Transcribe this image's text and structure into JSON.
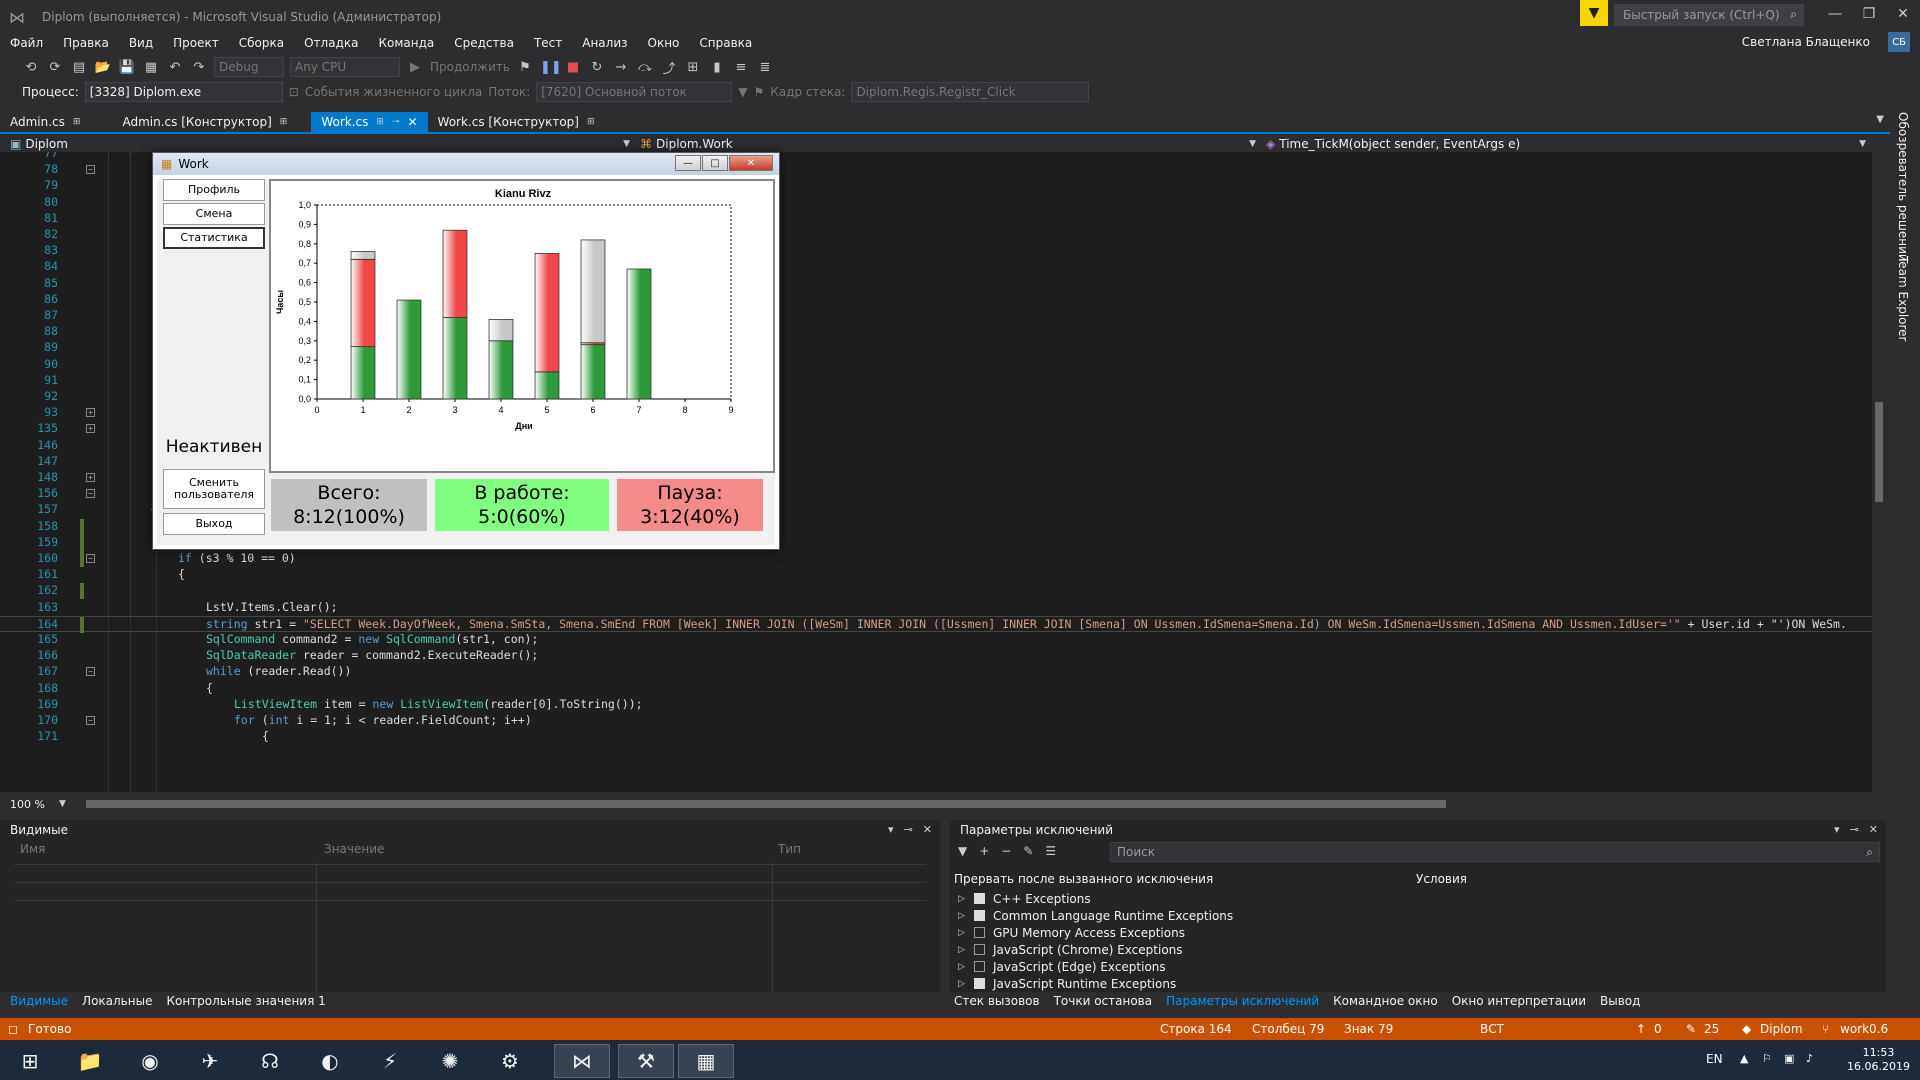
{
  "window": {
    "title": "Diplom (выполняется) - Microsoft Visual Studio  (Администратор)",
    "quick_launch_placeholder": "Быстрый запуск (Ctrl+Q)",
    "user_name": "Светлана Блащенко",
    "user_initials": "СБ"
  },
  "menu": [
    "Файл",
    "Правка",
    "Вид",
    "Проект",
    "Сборка",
    "Отладка",
    "Команда",
    "Средства",
    "Тест",
    "Анализ",
    "Окно",
    "Справка"
  ],
  "toolbar": {
    "config": "Debug",
    "platform": "Any CPU",
    "continue_label": "Продолжить"
  },
  "process_bar": {
    "process_label": "Процесс:",
    "process_value": "[3328] Diplom.exe",
    "lifecycle_label": "События жизненного цикла",
    "thread_label": "Поток:",
    "thread_value": "[7620] Основной поток",
    "stack_label": "Кадр стека:",
    "stack_value": "Diplom.Regis.Registr_Click"
  },
  "tabs": [
    {
      "label": "Admin.cs",
      "active": false
    },
    {
      "label": "Admin.cs [Конструктор]",
      "active": false
    },
    {
      "label": "Work.cs",
      "active": true
    },
    {
      "label": "Work.cs [Конструктор]",
      "active": false
    }
  ],
  "navbar": {
    "project": "Diplom",
    "class": "Diplom.Work",
    "member": "Time_TickM(object sender, EventArgs e)"
  },
  "code_lines": [
    {
      "n": "77",
      "text": ""
    },
    {
      "n": "78",
      "text": ""
    },
    {
      "n": "79",
      "text": ""
    },
    {
      "n": "80",
      "text": ""
    },
    {
      "n": "81",
      "text": ""
    },
    {
      "n": "82",
      "text": ""
    },
    {
      "n": "83",
      "text": ""
    },
    {
      "n": "84",
      "text": ""
    },
    {
      "n": "85",
      "text": ""
    },
    {
      "n": "86",
      "text": ""
    },
    {
      "n": "87",
      "text": ""
    },
    {
      "n": "88",
      "text": ""
    },
    {
      "n": "89",
      "text": ""
    },
    {
      "n": "90",
      "text": ""
    },
    {
      "n": "91",
      "text": ""
    },
    {
      "n": "92",
      "text": ""
    },
    {
      "n": "93",
      "text": ""
    },
    {
      "n": "135",
      "text": ""
    },
    {
      "n": "146",
      "text": ""
    },
    {
      "n": "147",
      "text": ""
    },
    {
      "n": "148",
      "text": ""
    },
    {
      "n": "156",
      "text": ""
    },
    {
      "n": "157",
      "text": "{"
    },
    {
      "n": "158",
      "text": "s3++;"
    },
    {
      "n": "159",
      "text": "con.Open();"
    },
    {
      "n": "160",
      "text": "if (s3 % 10 == 0)"
    },
    {
      "n": "161",
      "text": "{"
    },
    {
      "n": "162",
      "text": ""
    },
    {
      "n": "163",
      "text": "LstV.Items.Clear();"
    },
    {
      "n": "164",
      "text": "string str1 = \"SELECT Week.DayOfWeek, Smena.SmSta, Smena.SmEnd FROM [Week] INNER JOIN ([WeSm] INNER JOIN ([Ussmen] INNER JOIN [Smena] ON Ussmen.IdSmena=Smena.Id) ON WeSm.IdSmena=Ussmen.IdSmena AND Ussmen.IdUser='\" + User.id + \"')ON WeSm."
    },
    {
      "n": "165",
      "text": "SqlCommand command2 = new SqlCommand(str1, con);"
    },
    {
      "n": "166",
      "text": "SqlDataReader reader = command2.ExecuteReader();"
    },
    {
      "n": "167",
      "text": "while (reader.Read())"
    },
    {
      "n": "168",
      "text": "{"
    },
    {
      "n": "169",
      "text": "ListViewItem item = new ListViewItem(reader[0].ToString());"
    },
    {
      "n": "170",
      "text": "for (int i = 1; i < reader.FieldCount; i++)"
    },
    {
      "n": "171",
      "text": "{"
    }
  ],
  "zoom": "100 %",
  "work_window": {
    "title": "Work",
    "buttons": {
      "profile": "Профиль",
      "shift": "Смена",
      "stats": "Статистика",
      "change_user": "Сменить пользователя",
      "exit": "Выход"
    },
    "status": "Неактивен",
    "total_label": "Всего:",
    "total_value": "8:12(100%)",
    "work_label": "В работе:",
    "work_value": "5:0(60%)",
    "pause_label": "Пауза:",
    "pause_value": "3:12(40%)"
  },
  "chart_data": {
    "type": "bar",
    "title": "Kianu Rivz",
    "xlabel": "Дни",
    "ylabel": "Часы",
    "xlim": [
      0,
      9
    ],
    "ylim": [
      0,
      1.0
    ],
    "xticks": [
      "0",
      "1",
      "2",
      "3",
      "4",
      "5",
      "6",
      "7",
      "8",
      "9"
    ],
    "yticks": [
      "0,0",
      "0,1",
      "0,2",
      "0,3",
      "0,4",
      "0,5",
      "0,6",
      "0,7",
      "0,8",
      "0,9",
      "1,0"
    ],
    "x": [
      1,
      2,
      3,
      4,
      5,
      6,
      7
    ],
    "series": [
      {
        "color": "#2e9a3a",
        "values": [
          0.27,
          0.51,
          0.42,
          0.3,
          0.14,
          0.28,
          0.67
        ]
      },
      {
        "color": "#f04848",
        "values": [
          0.45,
          0.0,
          0.45,
          0.0,
          0.61,
          0.01,
          0.0
        ]
      },
      {
        "color": "#c8c8c8",
        "values": [
          0.04,
          0.0,
          0.0,
          0.11,
          0.0,
          0.53,
          0.0
        ]
      }
    ]
  },
  "watch_panel": {
    "title": "Видимые",
    "col_name": "Имя",
    "col_value": "Значение",
    "col_type": "Тип",
    "tabs": [
      "Видимые",
      "Локальные",
      "Контрольные значения 1"
    ]
  },
  "exceptions_panel": {
    "title": "Параметры исключений",
    "search_placeholder": "Поиск",
    "col_break": "Прервать после вызванного исключения",
    "col_conditions": "Условия",
    "items": [
      {
        "label": "C++ Exceptions",
        "checked": true
      },
      {
        "label": "Common Language Runtime Exceptions",
        "checked": true
      },
      {
        "label": "GPU Memory Access Exceptions",
        "checked": false
      },
      {
        "label": "JavaScript (Chrome) Exceptions",
        "checked": false
      },
      {
        "label": "JavaScript (Edge) Exceptions",
        "checked": false
      },
      {
        "label": "JavaScript Runtime Exceptions",
        "checked": true
      }
    ],
    "tabs": [
      "Стек вызовов",
      "Точки останова",
      "Параметры исключений",
      "Командное окно",
      "Окно интерпретации",
      "Вывод"
    ]
  },
  "right_rail": [
    "Обозреватель решений",
    "Team Explorer"
  ],
  "status_bar": {
    "ready": "Готово",
    "line": "Строка 164",
    "column": "Столбец 79",
    "char": "Знак 79",
    "ins": "ВСТ",
    "up_count": "0",
    "edit_count": "25",
    "project": "Diplom",
    "branch": "work0.6"
  },
  "taskbar": {
    "lang": "EN",
    "time": "11:53",
    "date": "16.06.2019"
  },
  "colors": {
    "accent": "#007acc",
    "status": "#ca5100"
  }
}
